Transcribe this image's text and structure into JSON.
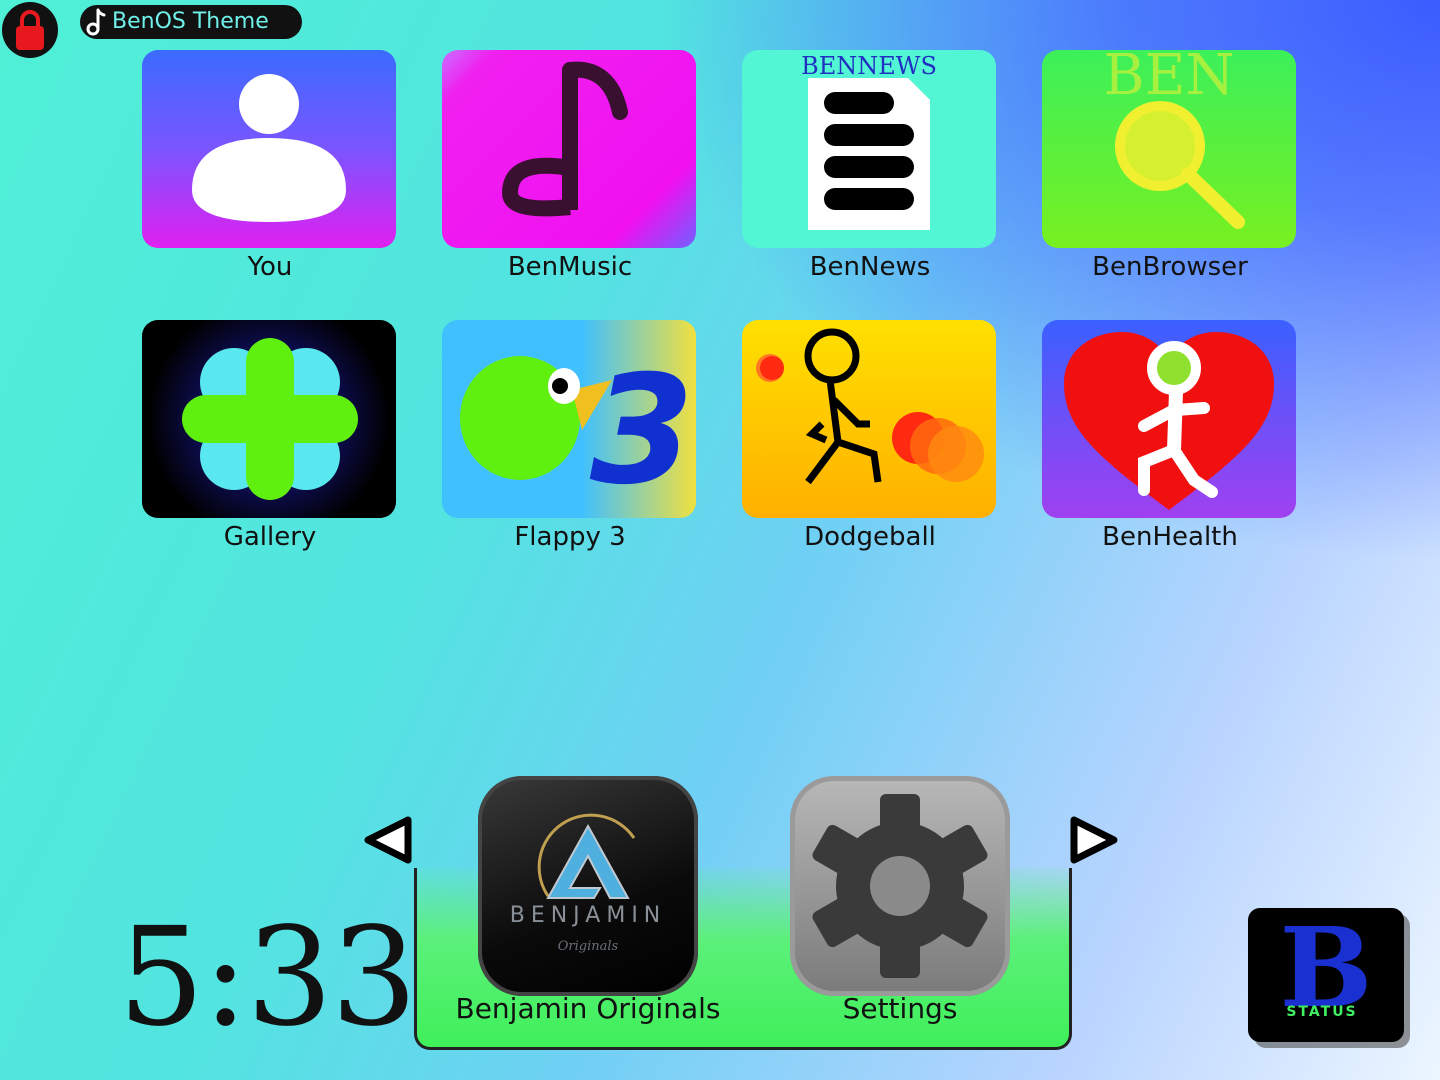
{
  "topbar": {
    "theme_label": "BenOS Theme"
  },
  "apps": [
    {
      "label": "You",
      "icon": "person-icon"
    },
    {
      "label": "BenMusic",
      "icon": "music-note-icon"
    },
    {
      "label": "BenNews",
      "icon": "newspaper-icon",
      "tile_text": "BENNEWS"
    },
    {
      "label": "BenBrowser",
      "icon": "magnifier-icon",
      "tile_text": "BEN"
    },
    {
      "label": "Gallery",
      "icon": "flower-icon"
    },
    {
      "label": "Flappy 3",
      "icon": "bird-icon",
      "tile_text": "3"
    },
    {
      "label": "Dodgeball",
      "icon": "stick-figure-icon"
    },
    {
      "label": "BenHealth",
      "icon": "heart-runner-icon"
    }
  ],
  "dock": {
    "apps": [
      {
        "label": "Benjamin Originals",
        "brand": "BENJAMIN",
        "sub": "Originals"
      },
      {
        "label": "Settings",
        "icon": "gear-icon"
      }
    ]
  },
  "clock": {
    "time": "5:33"
  },
  "status_button": {
    "letter": "B",
    "label": "STATUS"
  },
  "colors": {
    "accent_text": "#6ff0ea",
    "lock_red": "#e8191e",
    "dock_green": "#45f060"
  }
}
